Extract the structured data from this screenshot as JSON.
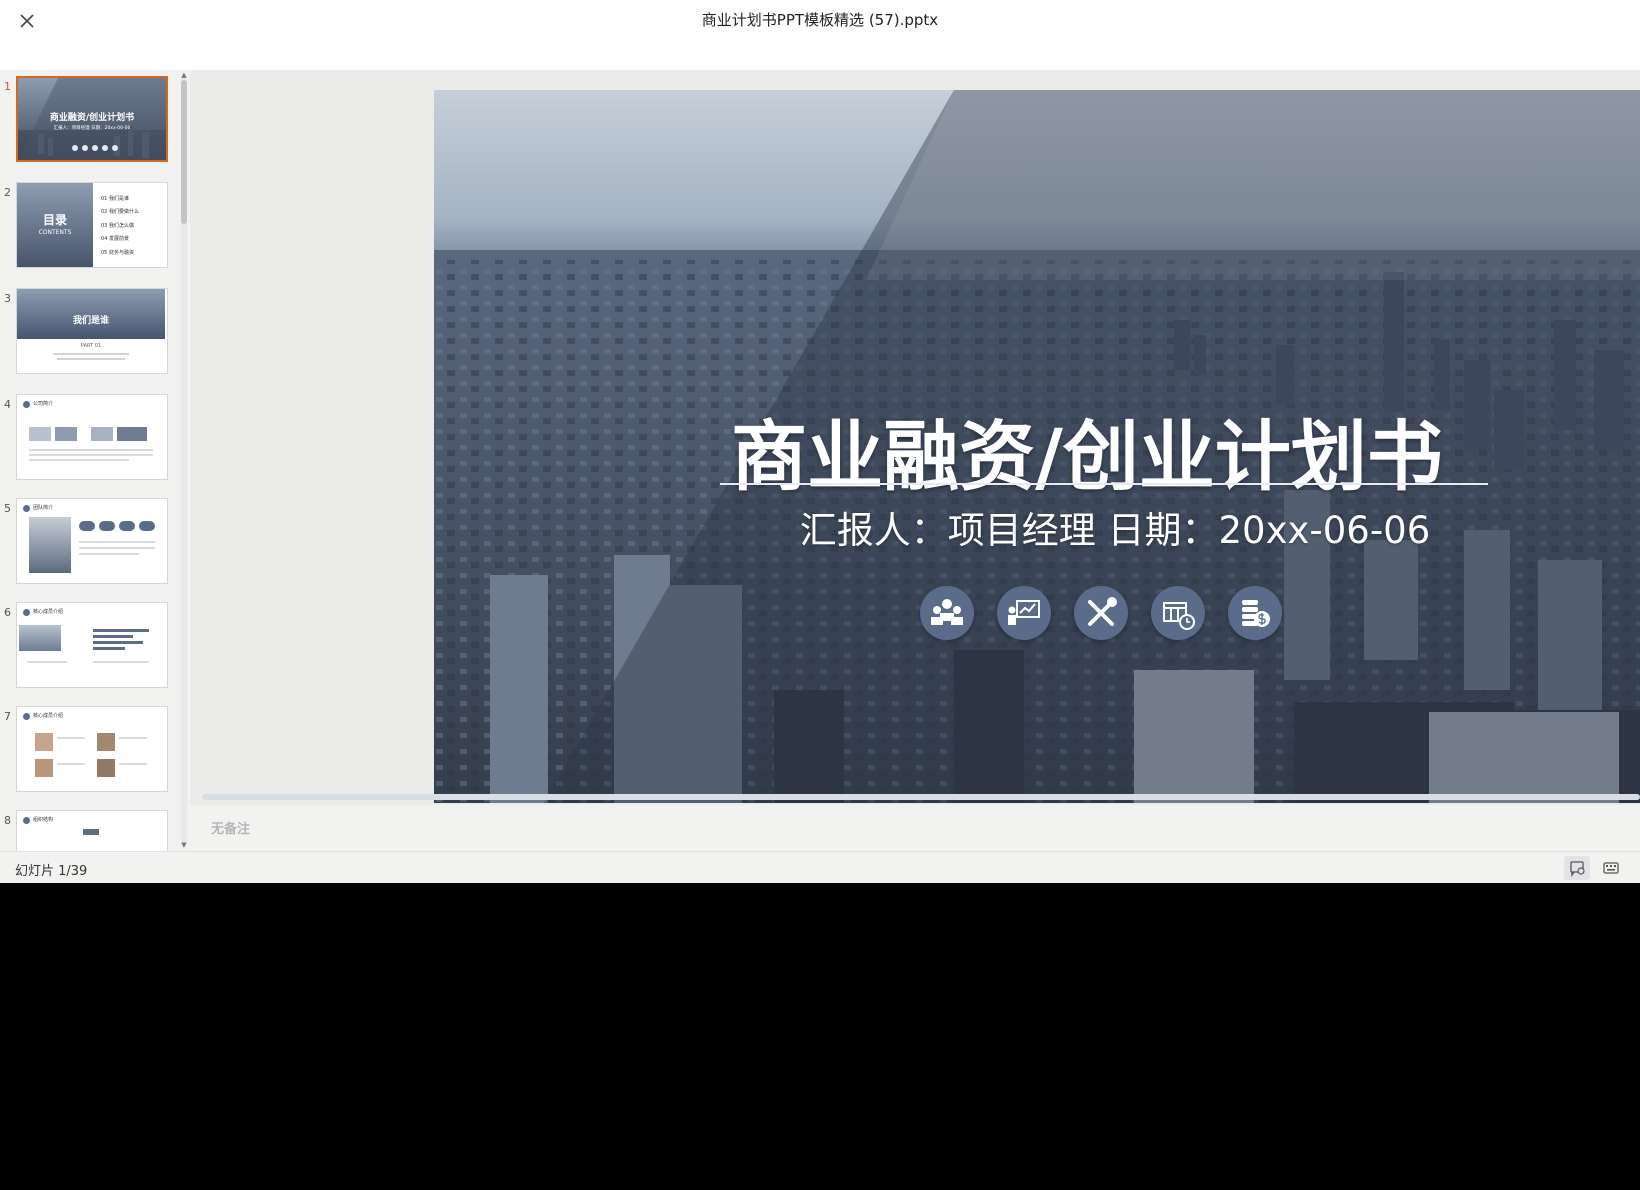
{
  "window": {
    "title": "商业计划书PPT模板精选 (57).pptx"
  },
  "slide": {
    "title": "商业融资/创业计划书",
    "subtitle": "汇报人：项目经理   日期：20xx-06-06",
    "icons": [
      "team-icon",
      "presentation-chart-icon",
      "tools-icon",
      "calendar-clock-icon",
      "coins-dollar-icon"
    ]
  },
  "thumbnails": [
    {
      "num": "1",
      "title": "商业融资/创业计划书",
      "sub": "汇报人：项目经理  日期：20xx-06-06",
      "active": true
    },
    {
      "num": "2",
      "heading": "目录",
      "heading_en": "CONTENTS",
      "items": [
        {
          "n": "01",
          "label": "我们是谁"
        },
        {
          "n": "02",
          "label": "我们要做什么"
        },
        {
          "n": "03",
          "label": "我们怎么做"
        },
        {
          "n": "04",
          "label": "发展前景"
        },
        {
          "n": "05",
          "label": "财务与融资"
        }
      ]
    },
    {
      "num": "3",
      "title": "我们是谁",
      "part": "PART 01"
    },
    {
      "num": "4",
      "title": "公司简介"
    },
    {
      "num": "5",
      "title": "团队简介"
    },
    {
      "num": "6",
      "title": "核心成员介绍"
    },
    {
      "num": "7",
      "title": "核心成员介绍"
    },
    {
      "num": "8",
      "title": "组织结构"
    }
  ],
  "notes": {
    "placeholder": "无备注"
  },
  "status": {
    "counter": "幻灯片 1/39"
  },
  "colors": {
    "accent": "#d2691e",
    "icon_bg": "#5b6c8a",
    "slide_sky": "#9aa9bb"
  }
}
